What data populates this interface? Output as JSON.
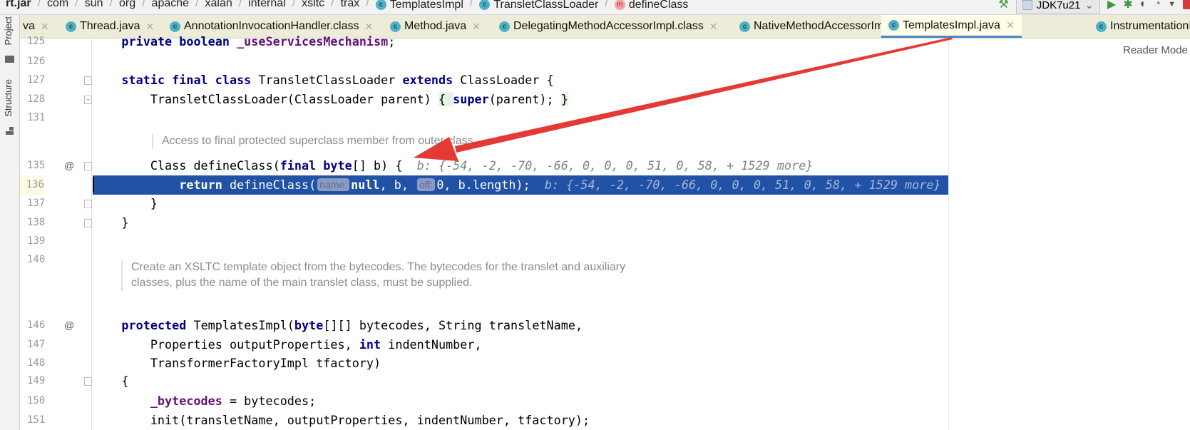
{
  "breadcrumb": [
    "rt.jar",
    "com",
    "sun",
    "org",
    "apache",
    "xalan",
    "internal",
    "xsltc",
    "trax",
    "TemplatesImpl",
    "TransletClassLoader",
    "defineClass"
  ],
  "toolbar": {
    "run_config": "JDK7u21"
  },
  "toolstrip": {
    "project": "Project",
    "structure": "Structure"
  },
  "tabs": [
    {
      "label": "va",
      "icon": "class-icon"
    },
    {
      "label": "Thread.java",
      "icon": "class-icon"
    },
    {
      "label": "AnnotationInvocationHandler.class",
      "icon": "class-icon"
    },
    {
      "label": "Method.java",
      "icon": "class-icon"
    },
    {
      "label": "DelegatingMethodAccessorImpl.class",
      "icon": "class-icon"
    },
    {
      "label": "NativeMethodAccessorImpl.class",
      "icon": "class-icon"
    },
    {
      "label": "TemplatesImpl.java",
      "icon": "class-icon",
      "active": true
    },
    {
      "label": "InstrumentationI",
      "icon": "class-icon"
    }
  ],
  "reader_mode": "Reader Mode",
  "colors": {
    "current_line": "#2252a6",
    "keyword": "#000080",
    "field": "#660e7a",
    "arrow": "#e53935"
  },
  "editor": {
    "lines": [
      {
        "num": "125",
        "tokens": [
          [
            "    ",
            ""
          ],
          [
            "private boolean ",
            "k"
          ],
          [
            "_useServicesMechanism",
            "f"
          ],
          [
            ";",
            ""
          ]
        ]
      },
      {
        "num": "126",
        "tokens": []
      },
      {
        "num": "127",
        "fold": "-",
        "tokens": [
          [
            "    ",
            ""
          ],
          [
            "static final class ",
            "k"
          ],
          [
            "TransletClassLoader ",
            ""
          ],
          [
            "extends ",
            "k"
          ],
          [
            "ClassLoader {",
            ""
          ]
        ]
      },
      {
        "num": "128",
        "fold": "+",
        "tokens": [
          [
            "        TransletClassLoader(ClassLoader parent) ",
            ""
          ],
          [
            "{ ",
            "bm"
          ],
          [
            "super",
            "k"
          ],
          [
            "(parent); ",
            ""
          ],
          [
            "}",
            "bm"
          ]
        ]
      },
      {
        "num": "131",
        "tokens": []
      },
      {
        "num": "135",
        "at": "@",
        "fold": "-",
        "tokens": [
          [
            "        Class defineClass(",
            ""
          ],
          [
            "final byte",
            "k"
          ],
          [
            "[] b) {  ",
            ""
          ],
          [
            "b: {-54, -2, -70, -66, 0, 0, 0, 51, 0, 58, + 1529 more}",
            "h"
          ]
        ]
      },
      {
        "num": "136",
        "current": true,
        "tokens": [
          [
            "            ",
            ""
          ],
          [
            "return ",
            "k"
          ],
          [
            "defineClass(",
            ""
          ],
          [
            "name:",
            "chip"
          ],
          [
            "null",
            "k"
          ],
          [
            ", b, ",
            ""
          ],
          [
            "off:",
            "chip"
          ],
          [
            "0, b.length);  ",
            ""
          ],
          [
            "b: {-54, -2, -70, -66, 0, 0, 0, 51, 0, 58, + 1529 more}",
            "h"
          ]
        ]
      },
      {
        "num": "137",
        "fold": "-",
        "tokens": [
          [
            "        }",
            ""
          ]
        ]
      },
      {
        "num": "138",
        "fold": "-",
        "tokens": [
          [
            "    }",
            ""
          ]
        ]
      },
      {
        "num": "139",
        "tokens": []
      },
      {
        "num": "140",
        "tokens": []
      },
      {
        "num": "146",
        "at": "@",
        "tokens": [
          [
            "    ",
            ""
          ],
          [
            "protected ",
            "k"
          ],
          [
            "TemplatesImpl(",
            ""
          ],
          [
            "byte",
            "k"
          ],
          [
            "[][] bytecodes, String transletName,",
            ""
          ]
        ]
      },
      {
        "num": "147",
        "tokens": [
          [
            "        Properties outputProperties, ",
            ""
          ],
          [
            "int ",
            "k"
          ],
          [
            "indentNumber,",
            ""
          ]
        ]
      },
      {
        "num": "148",
        "tokens": [
          [
            "        TransformerFactoryImpl tfactory)",
            ""
          ]
        ]
      },
      {
        "num": "149",
        "fold": "-",
        "tokens": [
          [
            "    {",
            ""
          ]
        ]
      },
      {
        "num": "150",
        "tokens": [
          [
            "        ",
            ""
          ],
          [
            "_bytecodes",
            "f"
          ],
          [
            " = bytecodes;",
            ""
          ]
        ]
      },
      {
        "num": "151",
        "tokens": [
          [
            "        init(transletName, outputProperties, indentNumber, tfactory);",
            ""
          ]
        ]
      }
    ],
    "docs": [
      {
        "text": "Access to final protected superclass member from outer class."
      },
      {
        "text": "Create an XSLTC template object from the bytecodes. The bytecodes for the translet and auxiliary classes, plus the name of the main translet class, must be supplied."
      }
    ]
  }
}
